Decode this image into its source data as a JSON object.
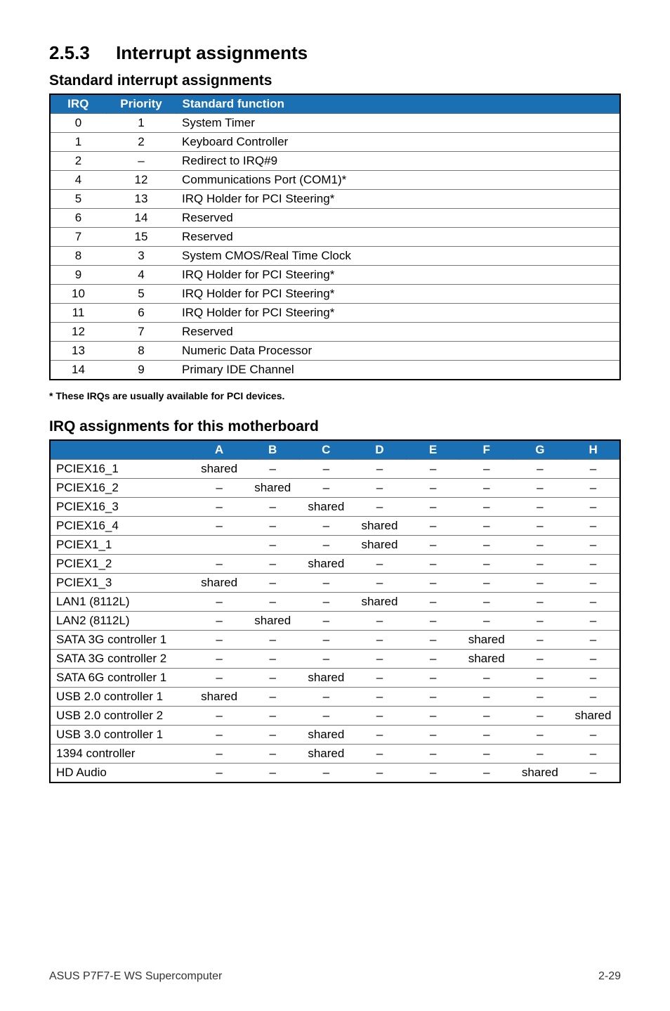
{
  "heading": {
    "number": "2.5.3",
    "title": "Interrupt assignments"
  },
  "subheadings": {
    "standard": "Standard interrupt assignments",
    "irq_mb": "IRQ assignments for this motherboard"
  },
  "table1": {
    "headers": [
      "IRQ",
      "Priority",
      "Standard function"
    ],
    "rows": [
      {
        "irq": "0",
        "pri": "1",
        "fn": "System Timer"
      },
      {
        "irq": "1",
        "pri": "2",
        "fn": "Keyboard Controller"
      },
      {
        "irq": "2",
        "pri": "–",
        "fn": "Redirect to IRQ#9"
      },
      {
        "irq": "4",
        "pri": "12",
        "fn": "Communications Port (COM1)*"
      },
      {
        "irq": "5",
        "pri": "13",
        "fn": "IRQ Holder for PCI Steering*"
      },
      {
        "irq": "6",
        "pri": "14",
        "fn": "Reserved"
      },
      {
        "irq": "7",
        "pri": "15",
        "fn": "Reserved"
      },
      {
        "irq": "8",
        "pri": "3",
        "fn": "System CMOS/Real Time Clock"
      },
      {
        "irq": "9",
        "pri": "4",
        "fn": "IRQ Holder for PCI Steering*"
      },
      {
        "irq": "10",
        "pri": "5",
        "fn": "IRQ Holder for PCI Steering*"
      },
      {
        "irq": "11",
        "pri": "6",
        "fn": "IRQ Holder for PCI Steering*"
      },
      {
        "irq": "12",
        "pri": "7",
        "fn": "Reserved"
      },
      {
        "irq": "13",
        "pri": "8",
        "fn": "Numeric Data Processor"
      },
      {
        "irq": "14",
        "pri": "9",
        "fn": "Primary IDE Channel"
      }
    ]
  },
  "footnote": "* These IRQs are usually available for PCI devices.",
  "table2": {
    "headers": [
      "",
      "A",
      "B",
      "C",
      "D",
      "E",
      "F",
      "G",
      "H"
    ],
    "rows": [
      {
        "name": "PCIEX16_1",
        "A": "shared",
        "B": "–",
        "C": "–",
        "D": "–",
        "E": "–",
        "F": "–",
        "G": "–",
        "H": "–"
      },
      {
        "name": "PCIEX16_2",
        "A": "–",
        "B": "shared",
        "C": "–",
        "D": "–",
        "E": "–",
        "F": "–",
        "G": "–",
        "H": "–"
      },
      {
        "name": "PCIEX16_3",
        "A": "–",
        "B": "–",
        "C": "shared",
        "D": "–",
        "E": "–",
        "F": "–",
        "G": "–",
        "H": "–"
      },
      {
        "name": "PCIEX16_4",
        "A": "–",
        "B": "–",
        "C": "–",
        "D": "shared",
        "E": "–",
        "F": "–",
        "G": "–",
        "H": "–"
      },
      {
        "name": "PCIEX1_1",
        "A": "",
        "B": "–",
        "C": "–",
        "D": "shared",
        "E": "–",
        "F": "–",
        "G": "–",
        "H": "–"
      },
      {
        "name": "PCIEX1_2",
        "A": "–",
        "B": "–",
        "C": "shared",
        "D": "–",
        "E": "–",
        "F": "–",
        "G": "–",
        "H": "–"
      },
      {
        "name": "PCIEX1_3",
        "A": "shared",
        "B": "–",
        "C": "–",
        "D": "–",
        "E": "–",
        "F": "–",
        "G": "–",
        "H": "–"
      },
      {
        "name": "LAN1 (8112L)",
        "A": "–",
        "B": "–",
        "C": "–",
        "D": "shared",
        "E": "–",
        "F": "–",
        "G": "–",
        "H": "–"
      },
      {
        "name": "LAN2 (8112L)",
        "A": "–",
        "B": "shared",
        "C": "–",
        "D": "–",
        "E": "–",
        "F": "–",
        "G": "–",
        "H": "–"
      },
      {
        "name": "SATA 3G controller 1",
        "A": "–",
        "B": "–",
        "C": "–",
        "D": "–",
        "E": "–",
        "F": "shared",
        "G": "–",
        "H": "–"
      },
      {
        "name": "SATA 3G controller 2",
        "A": "–",
        "B": "–",
        "C": "–",
        "D": "–",
        "E": "–",
        "F": "shared",
        "G": "–",
        "H": "–"
      },
      {
        "name": "SATA 6G controller 1",
        "A": "–",
        "B": "–",
        "C": "shared",
        "D": "–",
        "E": "–",
        "F": "–",
        "G": "–",
        "H": "–"
      },
      {
        "name": "USB 2.0 controller 1",
        "A": "shared",
        "B": "–",
        "C": "–",
        "D": "–",
        "E": "–",
        "F": "–",
        "G": "–",
        "H": "–"
      },
      {
        "name": "USB 2.0 controller 2",
        "A": "–",
        "B": "–",
        "C": "–",
        "D": "–",
        "E": "–",
        "F": "–",
        "G": "–",
        "H": "shared"
      },
      {
        "name": "USB 3.0 controller 1",
        "A": "–",
        "B": "–",
        "C": "shared",
        "D": "–",
        "E": "–",
        "F": "–",
        "G": "–",
        "H": "–"
      },
      {
        "name": "1394 controller",
        "A": "–",
        "B": "–",
        "C": "shared",
        "D": "–",
        "E": "–",
        "F": "–",
        "G": "–",
        "H": "–"
      },
      {
        "name": "HD Audio",
        "A": "–",
        "B": "–",
        "C": "–",
        "D": "–",
        "E": "–",
        "F": "–",
        "G": "shared",
        "H": "–"
      }
    ]
  },
  "footer": {
    "left": "ASUS P7F7-E WS Supercomputer",
    "right": "2-29"
  }
}
